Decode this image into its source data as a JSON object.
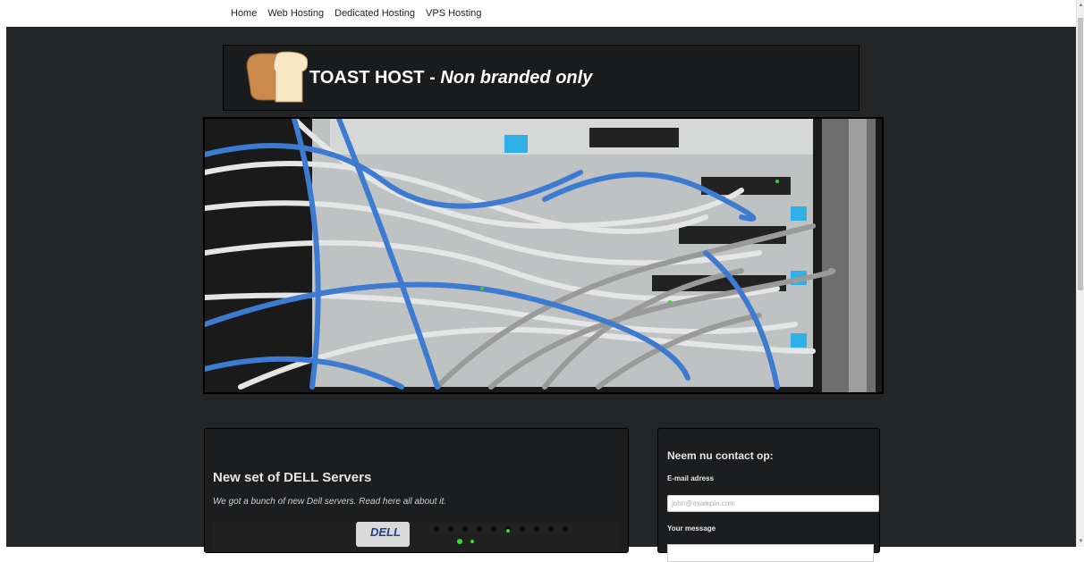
{
  "nav": {
    "items": [
      "Home",
      "Web Hosting",
      "Dedicated Hosting",
      "VPS Hosting"
    ]
  },
  "header": {
    "title_main": "TOAST HOST - ",
    "title_italic": "Non branded only",
    "logo_icon": "toast-bread-icon"
  },
  "hero": {
    "image": "network-switch-cables-photo"
  },
  "post": {
    "title": "New set of DELL Servers",
    "excerpt": "We got a bunch of new Dell servers. Read here all about it.",
    "image": "dell-server-photo",
    "image_brand": "DELL"
  },
  "contact": {
    "heading": "Neem nu contact op:",
    "email_label": "E-mail adress",
    "email_placeholder": "john@example.com",
    "message_label": "Your message"
  },
  "colors": {
    "page_bg": "#232527",
    "panel_bg": "#1c1d1f",
    "cable_blue": "#3d7bd1"
  }
}
